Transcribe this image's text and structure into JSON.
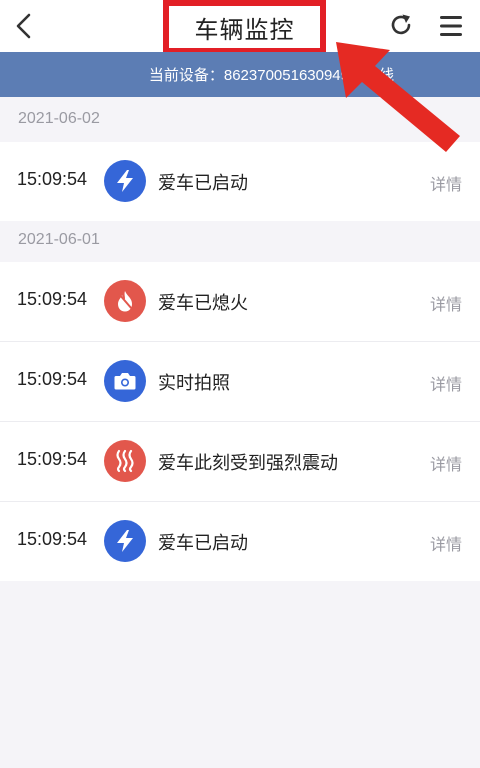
{
  "header": {
    "title": "车辆监控",
    "back_icon": "chevron-left-icon",
    "refresh_icon": "refresh-icon",
    "menu_icon": "hamburger-menu-icon"
  },
  "device_bar": {
    "text": "当前设备：862370051630949（离线"
  },
  "groups": [
    {
      "date": "2021-06-02",
      "rows": [
        {
          "time": "15:09:54",
          "icon": "lightning-icon",
          "color": "#3566d8",
          "event": "爱车已启动",
          "detail": "详情"
        }
      ]
    },
    {
      "date": "2021-06-01",
      "rows": [
        {
          "time": "15:09:54",
          "icon": "flame-icon",
          "color": "#e2574c",
          "event": "爱车已熄火",
          "detail": "详情"
        },
        {
          "time": "15:09:54",
          "icon": "camera-icon",
          "color": "#3566d8",
          "event": "实时拍照",
          "detail": "详情"
        },
        {
          "time": "15:09:54",
          "icon": "vibration-icon",
          "color": "#e2574c",
          "event": "爱车此刻受到强烈震动",
          "detail": "详情"
        },
        {
          "time": "15:09:54",
          "icon": "lightning-icon",
          "color": "#3566d8",
          "event": "爱车已启动",
          "detail": "详情"
        }
      ]
    }
  ],
  "colors": {
    "accent_bar": "#5c7db4",
    "highlight": "#e21f26"
  }
}
